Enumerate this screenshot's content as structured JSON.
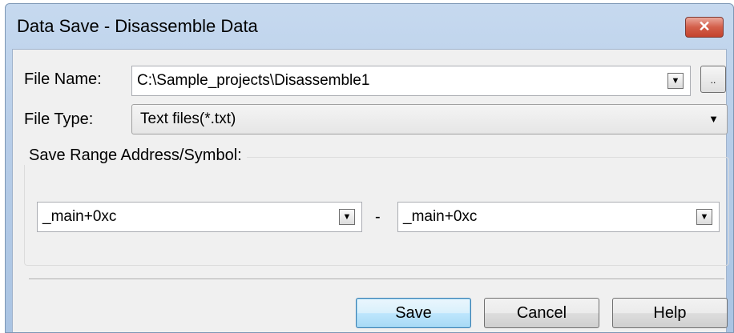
{
  "window": {
    "title": "Data Save - Disassemble Data",
    "close_glyph": "✕"
  },
  "file_name": {
    "label": "File Name:",
    "value": "C:\\Sample_projects\\Disassemble1",
    "browse_label": "..",
    "drop_glyph": "▼"
  },
  "file_type": {
    "label": "File Type:",
    "value": "Text files(*.txt)",
    "arrow_glyph": "▼"
  },
  "range": {
    "group_title": "Save Range Address/Symbol:",
    "start": {
      "value": "_main+0xc",
      "drop_glyph": "▼"
    },
    "separator": "-",
    "end": {
      "value": "_main+0xc",
      "drop_glyph": "▼"
    }
  },
  "buttons": {
    "save": "Save",
    "cancel": "Cancel",
    "help": "Help"
  },
  "colors": {
    "titlebar": "#b7cde8",
    "close": "#c4432e",
    "client": "#f0f0f0"
  }
}
